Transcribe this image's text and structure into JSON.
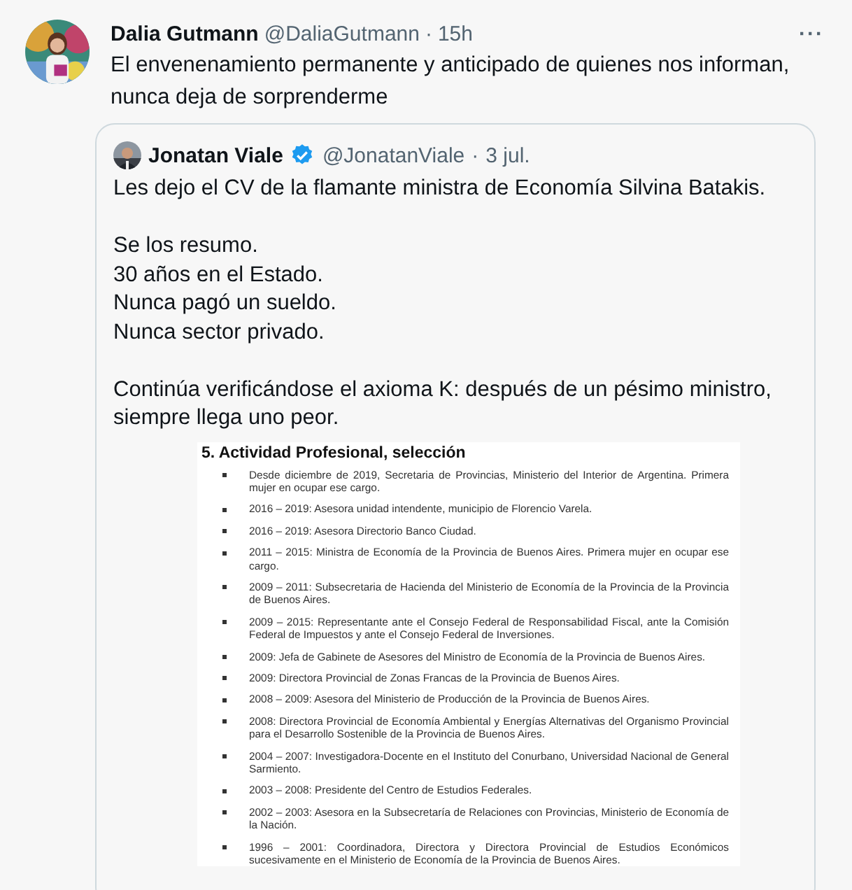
{
  "tweet": {
    "author": {
      "name": "Dalia Gutmann",
      "handle": "@DaliaGutmann",
      "separator": "·",
      "time": "15h"
    },
    "more": "···",
    "text": "El envenenamiento permanente y anticipado de quienes nos informan, nunca deja de sorprenderme",
    "quote": {
      "author": {
        "name": "Jonatan Viale",
        "verified": true,
        "handle": "@JonatanViale",
        "separator": "·",
        "time": "3 jul."
      },
      "paragraphs": [
        [
          "Les dejo el CV de la flamante ministra de Economía Silvina Batakis."
        ],
        [
          "Se los resumo.",
          "30 años en el Estado.",
          "Nunca pagó un sueldo.",
          "Nunca sector privado."
        ],
        [
          "Continúa verificándose el axioma K: después de un pésimo ministro, siempre llega uno peor."
        ]
      ],
      "document": {
        "heading": "5. Actividad Profesional, selección",
        "items": [
          "Desde diciembre de 2019, Secretaria de Provincias, Ministerio del Interior de Argentina. Primera mujer en ocupar ese cargo.",
          "2016 – 2019: Asesora unidad intendente, municipio de Florencio Varela.",
          "2016 – 2019: Asesora Directorio Banco Ciudad.",
          "2011 – 2015: Ministra de Economía de la Provincia de Buenos Aires. Primera mujer en ocupar ese cargo.",
          "2009 – 2011: Subsecretaria de Hacienda del Ministerio de Economía de la Provincia de la Provincia de Buenos Aires.",
          "2009 – 2015: Representante ante el Consejo Federal de Responsabilidad Fiscal, ante la Comisión Federal de Impuestos y ante el Consejo Federal de Inversiones.",
          "2009: Jefa de Gabinete de Asesores del Ministro de Economía de la Provincia de Buenos Aires.",
          "2009: Directora Provincial de Zonas Francas de la Provincia de Buenos Aires.",
          "2008 – 2009: Asesora del Ministerio de Producción de la Provincia de Buenos Aires.",
          "2008: Directora Provincial de Economía Ambiental y Energías Alternativas del Organismo Provincial para el Desarrollo Sostenible de la Provincia de Buenos Aires.",
          "2004 – 2007: Investigadora-Docente en el Instituto del Conurbano, Universidad Nacional de General Sarmiento.",
          "2003 – 2008: Presidente del Centro de Estudios Federales.",
          "2002 – 2003: Asesora en la Subsecretaría de Relaciones con Provincias, Ministerio de Economía de la Nación.",
          "1996 – 2001: Coordinadora, Directora y Directora Provincial de Estudios Económicos sucesivamente en el Ministerio de Economía de la Provincia de Buenos Aires."
        ]
      }
    }
  }
}
